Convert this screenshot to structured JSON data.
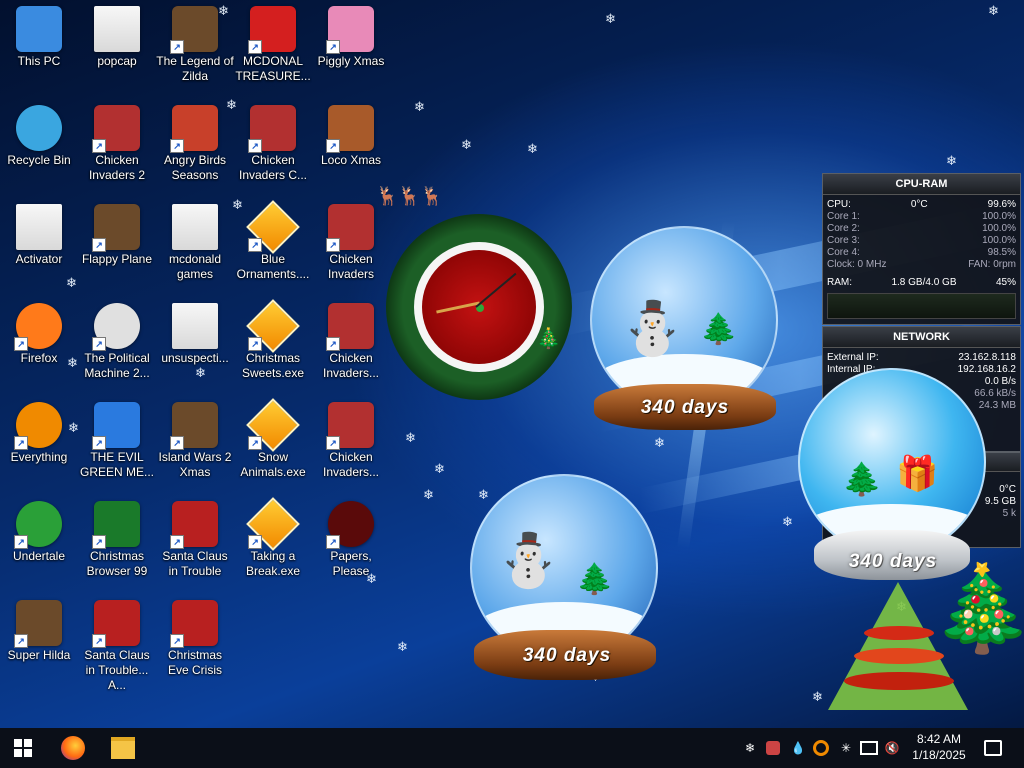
{
  "desktop": {
    "icons": [
      {
        "label": "This PC",
        "icon": "computer-icon"
      },
      {
        "label": "popcap",
        "icon": "folder-icon"
      },
      {
        "label": "The Legend of Zilda",
        "icon": "game-icon"
      },
      {
        "label": "MCDONAL TREASURE...",
        "icon": "mcdonalds-icon"
      },
      {
        "label": "Piggly Xmas",
        "icon": "pig-icon"
      },
      {
        "label": "Recycle Bin",
        "icon": "recycle-bin-icon"
      },
      {
        "label": "Chicken Invaders 2",
        "icon": "chicken-icon"
      },
      {
        "label": "Angry Birds Seasons",
        "icon": "angry-birds-icon"
      },
      {
        "label": "Chicken Invaders C...",
        "icon": "chicken-icon"
      },
      {
        "label": "Loco Xmas",
        "icon": "bear-icon"
      },
      {
        "label": "Activator",
        "icon": "folder-icon"
      },
      {
        "label": "Flappy Plane",
        "icon": "game-icon"
      },
      {
        "label": "mcdonald games",
        "icon": "folder-icon"
      },
      {
        "label": "Blue Ornaments....",
        "icon": "exe-icon"
      },
      {
        "label": "Chicken Invaders",
        "icon": "chicken-icon"
      },
      {
        "label": "Firefox",
        "icon": "firefox-icon"
      },
      {
        "label": "The Political Machine 2...",
        "icon": "political-icon"
      },
      {
        "label": "unsuspecti...",
        "icon": "folder-icon"
      },
      {
        "label": "Christmas Sweets.exe",
        "icon": "exe-icon"
      },
      {
        "label": "Chicken Invaders...",
        "icon": "chicken-icon"
      },
      {
        "label": "Everything",
        "icon": "search-icon"
      },
      {
        "label": "THE EVIL GREEN ME...",
        "icon": "messenger-icon"
      },
      {
        "label": "Island Wars 2 Xmas",
        "icon": "game-icon"
      },
      {
        "label": "Snow Animals.exe",
        "icon": "exe-icon"
      },
      {
        "label": "Chicken Invaders...",
        "icon": "chicken-icon"
      },
      {
        "label": "Undertale",
        "icon": "undertale-icon"
      },
      {
        "label": "Christmas Browser 99",
        "icon": "tree-icon"
      },
      {
        "label": "Santa Claus in Trouble",
        "icon": "santa-icon"
      },
      {
        "label": "Taking a Break.exe",
        "icon": "exe-icon"
      },
      {
        "label": "Papers, Please",
        "icon": "papers-icon"
      },
      {
        "label": "Super Hilda",
        "icon": "game-icon"
      },
      {
        "label": "Santa Claus in Trouble... A...",
        "icon": "santa-icon"
      },
      {
        "label": "Christmas Eve Crisis",
        "icon": "santa-icon"
      }
    ]
  },
  "cpu_gadget": {
    "title": "CPU-RAM",
    "cpu_label": "CPU:",
    "cpu_temp": "0°C",
    "cpu_pct": "99.6%",
    "cores": [
      {
        "label": "Core 1:",
        "value": "100.0%"
      },
      {
        "label": "Core 2:",
        "value": "100.0%"
      },
      {
        "label": "Core 3:",
        "value": "100.0%"
      },
      {
        "label": "Core 4:",
        "value": "98.5%"
      }
    ],
    "clock": "Clock: 0 MHz",
    "fan": "FAN: 0rpm",
    "ram_label": "RAM:",
    "ram_value": "1.8 GB/4.0 GB",
    "ram_pct": "45%"
  },
  "network_gadget": {
    "title": "NETWORK",
    "external_label": "External IP:",
    "external_ip": "23.162.8.118",
    "internal_label": "Internal IP:",
    "internal_ip": "192.168.16.2",
    "rows": [
      "0.0 B/s",
      "66.6 kB/s",
      "24.3 MB"
    ]
  },
  "third_gadget": {
    "temp": "0°C",
    "size": "9.5 GB",
    "rate": "5 k"
  },
  "snow_globes": [
    {
      "days": "340 days"
    },
    {
      "days": "340 days"
    },
    {
      "days": "340 days"
    }
  ],
  "taskbar": {
    "start_icon": "windows-icon",
    "pinned": [
      "firefox-icon",
      "file-explorer-icon"
    ],
    "tray_icons": [
      "snowflake-icon",
      "app-icon",
      "water-drop-icon",
      "search-icon",
      "snow-icon",
      "network-icon",
      "volume-muted-icon"
    ],
    "time": "8:42 AM",
    "date": "1/18/2025",
    "notification_icon": "notification-icon"
  }
}
